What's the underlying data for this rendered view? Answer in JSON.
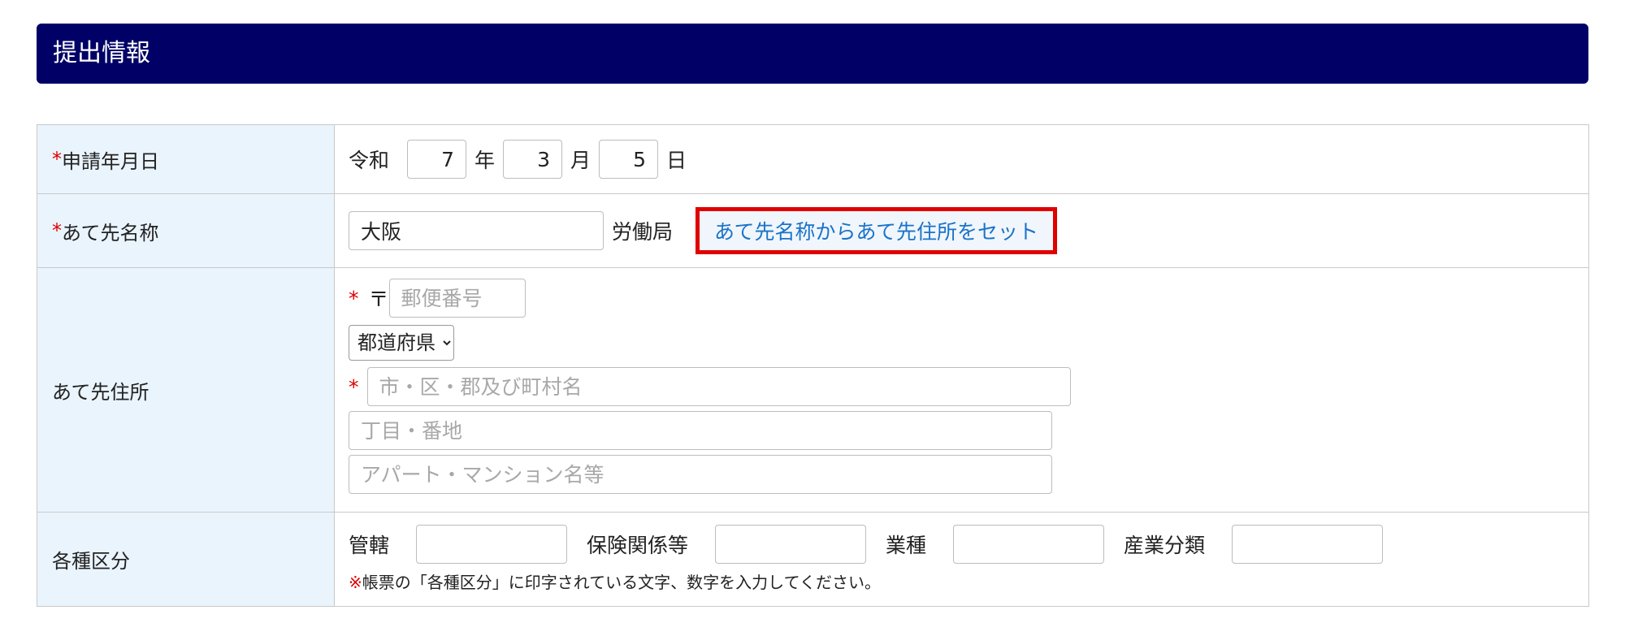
{
  "header": {
    "title": "提出情報"
  },
  "rows": {
    "date": {
      "required_mark": "*",
      "label": "申請年月日",
      "era": "令和",
      "year_value": "7",
      "year_unit": "年",
      "month_value": "3",
      "month_unit": "月",
      "day_value": "5",
      "day_unit": "日"
    },
    "recipient_name": {
      "required_mark": "*",
      "label": "あて先名称",
      "value": "大阪",
      "suffix": "労働局",
      "set_button": "あて先名称からあて先住所をセット"
    },
    "recipient_address": {
      "label": "あて先住所",
      "required_mark": "*",
      "postal_mark": "〒",
      "postal_placeholder": "郵便番号",
      "prefecture_selected": "都道府県",
      "city_placeholder": "市・区・郡及び町村名",
      "street_placeholder": "丁目・番地",
      "building_placeholder": "アパート・マンション名等"
    },
    "classification": {
      "label": "各種区分",
      "fields": [
        {
          "label": "管轄",
          "value": ""
        },
        {
          "label": "保険関係等",
          "value": ""
        },
        {
          "label": "業種",
          "value": ""
        },
        {
          "label": "産業分類",
          "value": ""
        }
      ],
      "note_mark": "※",
      "note": "帳票の「各種区分」に印字されている文字、数字を入力してください。"
    }
  },
  "colors": {
    "header_bg": "#000066",
    "label_bg": "#eaf4fd",
    "required": "#e00000",
    "button_text": "#1a73c8",
    "highlight_border": "#e00000"
  }
}
